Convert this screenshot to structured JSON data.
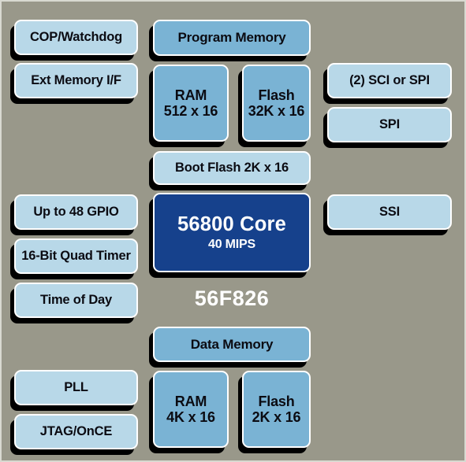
{
  "diagram": {
    "title": "56F826",
    "background_color": "#99988a",
    "colors": {
      "peripheral_fill": "#b8d8e8",
      "memory_fill": "#7ab3d4",
      "core_fill": "#16418c",
      "block_border": "#ffffff",
      "shadow": "#000000",
      "label_text": "#ffffff",
      "block_text": "#0b0b12"
    },
    "part_label": "56F826",
    "left_column": [
      {
        "label": "COP/Watchdog"
      },
      {
        "label": "Ext Memory I/F"
      },
      {
        "label": "Up to 48 GPIO"
      },
      {
        "label": "16-Bit Quad Timer"
      },
      {
        "label": "Time of Day"
      },
      {
        "label": "PLL"
      },
      {
        "label": "JTAG/OnCE"
      }
    ],
    "right_column": [
      {
        "label": "(2) SCI or SPI"
      },
      {
        "label": "SPI"
      },
      {
        "label": "SSI"
      }
    ],
    "program_memory": {
      "header": "Program Memory",
      "cells": [
        {
          "line1": "RAM",
          "line2": "512 x 16"
        },
        {
          "line1": "Flash",
          "line2": "32K x 16"
        }
      ],
      "boot_flash": "Boot Flash 2K x 16"
    },
    "core": {
      "line1": "56800 Core",
      "line2": "40 MIPS"
    },
    "data_memory": {
      "header": "Data Memory",
      "cells": [
        {
          "line1": "RAM",
          "line2": "4K x 16"
        },
        {
          "line1": "Flash",
          "line2": "2K x 16"
        }
      ]
    }
  }
}
